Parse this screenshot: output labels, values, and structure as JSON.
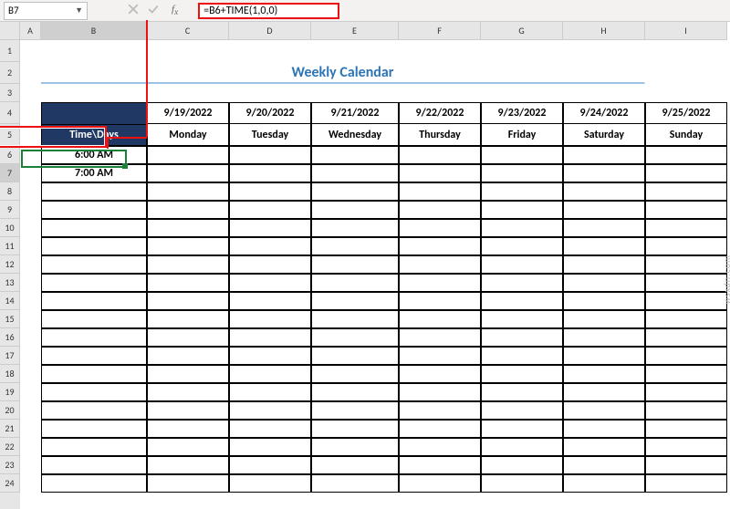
{
  "name_box": "B7",
  "formula": "=B6+TIME(1,0,0)",
  "columns": [
    "A",
    "B",
    "C",
    "D",
    "E",
    "F",
    "G",
    "H",
    "I"
  ],
  "row_headers": [
    1,
    2,
    3,
    4,
    5,
    6,
    7,
    8,
    9,
    10,
    11,
    12,
    13,
    14,
    15,
    16,
    17,
    18,
    19,
    20,
    21,
    22,
    23,
    24
  ],
  "title": "Weekly Calendar",
  "time_days_header": "Time\\Days",
  "dates": [
    "9/19/2022",
    "9/20/2022",
    "9/21/2022",
    "9/22/2022",
    "9/23/2022",
    "9/24/2022",
    "9/25/2022"
  ],
  "days": [
    "Monday",
    "Tuesday",
    "Wednesday",
    "Thursday",
    "Friday",
    "Saturday",
    "Sunday"
  ],
  "times": [
    "6:00 AM",
    "7:00 AM"
  ],
  "watermark": "wsxdn.com",
  "active_cell": {
    "row": 7,
    "col": "B"
  },
  "chart_data": {
    "type": "table",
    "title": "Weekly Calendar",
    "columns": [
      "Time\\Days",
      "9/19/2022 Monday",
      "9/20/2022 Tuesday",
      "9/21/2022 Wednesday",
      "9/22/2022 Thursday",
      "9/23/2022 Friday",
      "9/24/2022 Saturday",
      "9/25/2022 Sunday"
    ],
    "rows": [
      [
        "6:00 AM",
        "",
        "",
        "",
        "",
        "",
        "",
        ""
      ],
      [
        "7:00 AM",
        "",
        "",
        "",
        "",
        "",
        "",
        ""
      ]
    ],
    "formula_B7": "=B6+TIME(1,0,0)"
  }
}
